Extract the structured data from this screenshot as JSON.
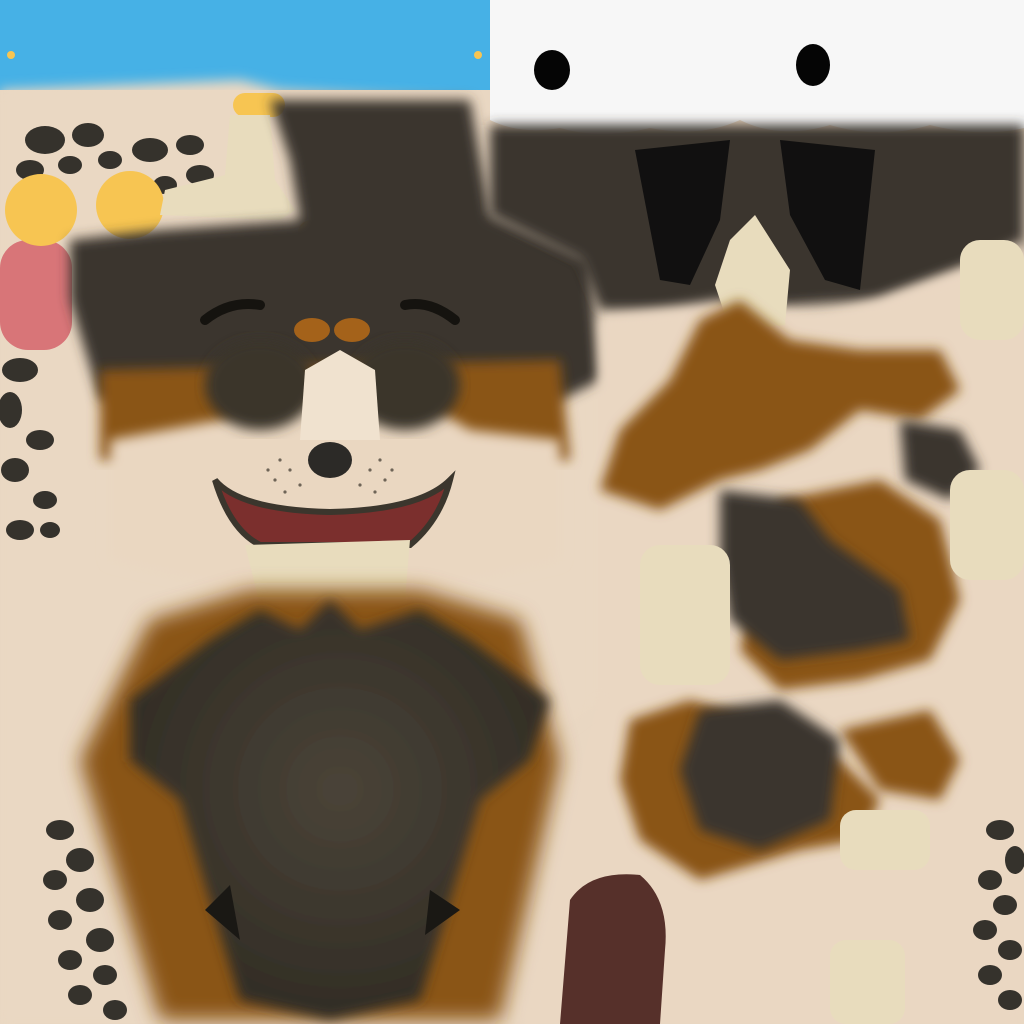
{
  "image": {
    "kind": "dog-texture-atlas",
    "colors": {
      "cream": "#e9d7c2",
      "cream_light": "#f3e6d3",
      "pale_yellow": "#e8dcbd",
      "dark_fur": "#3b362d",
      "tan_fur": "#8a5414",
      "tan_light": "#a4621a",
      "sky_blue": "#46b1e6",
      "white": "#f7f7f7",
      "yellow": "#f7c552",
      "pink": "#d87578",
      "mouth_red": "#7b2f2d",
      "nose": "#2c2a27",
      "pupil": "#050505",
      "tongue_brown": "#56302a"
    },
    "icons": {
      "eye_patch": "white-eye-patch-with-black-pupils",
      "paw_pads": "black-paw-spots",
      "face": "smiling-dog-face"
    }
  }
}
